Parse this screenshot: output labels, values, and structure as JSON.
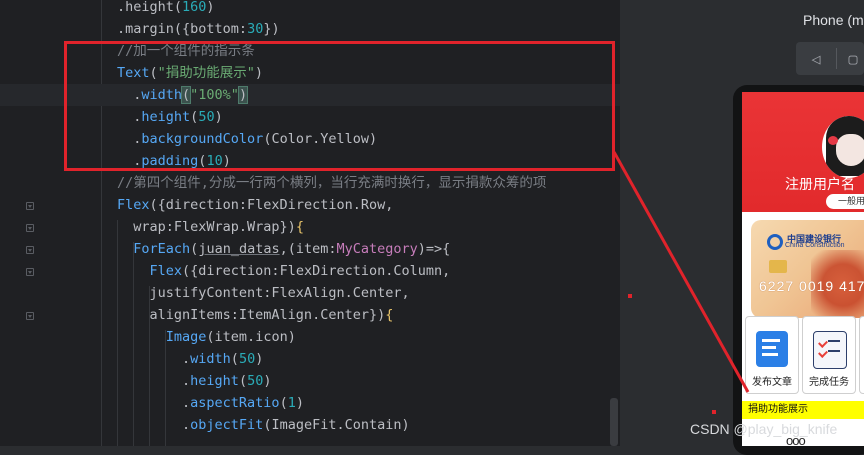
{
  "editor": {
    "lines": [
      [
        {
          "c": "plain",
          "t": ".height("
        },
        {
          "c": "num",
          "t": "160"
        },
        {
          "c": "plain",
          "t": ")"
        }
      ],
      [
        {
          "c": "plain",
          "t": ".margin({"
        },
        {
          "c": "plain",
          "t": "bottom:"
        },
        {
          "c": "num",
          "t": "30"
        },
        {
          "c": "plain",
          "t": "})"
        }
      ],
      [
        {
          "c": "cmt",
          "t": "//加一个组件的指示条"
        }
      ],
      [
        {
          "c": "kw-fn",
          "t": "Text"
        },
        {
          "c": "plain",
          "t": "("
        },
        {
          "c": "str",
          "t": "\"捐助功能展示\""
        },
        {
          "c": "plain",
          "t": ")"
        }
      ],
      [
        {
          "c": "plain",
          "t": "  ."
        },
        {
          "c": "kw-fn",
          "t": "width"
        },
        {
          "c": "brkt-hl",
          "t": "("
        },
        {
          "c": "str",
          "t": "\"100%\""
        },
        {
          "c": "brkt-hl",
          "t": ")"
        }
      ],
      [
        {
          "c": "plain",
          "t": "  ."
        },
        {
          "c": "kw-fn",
          "t": "height"
        },
        {
          "c": "plain",
          "t": "("
        },
        {
          "c": "num",
          "t": "50"
        },
        {
          "c": "plain",
          "t": ")"
        }
      ],
      [
        {
          "c": "plain",
          "t": "  ."
        },
        {
          "c": "kw-fn",
          "t": "backgroundColor"
        },
        {
          "c": "plain",
          "t": "(Color.Yellow)"
        }
      ],
      [
        {
          "c": "plain",
          "t": "  ."
        },
        {
          "c": "kw-fn",
          "t": "padding"
        },
        {
          "c": "plain",
          "t": "("
        },
        {
          "c": "num",
          "t": "10"
        },
        {
          "c": "plain",
          "t": ")"
        }
      ],
      [
        {
          "c": "cmt",
          "t": "//第四个组件,分成一行两个横列，当行充满时换行，显示捐款众筹的项"
        }
      ],
      [
        {
          "c": "kw-fn",
          "t": "Flex"
        },
        {
          "c": "plain",
          "t": "({direction:FlexDirection.Row,"
        }
      ],
      [
        {
          "c": "plain",
          "t": "  wrap:FlexWrap.Wrap})"
        },
        {
          "c": "brkt-y",
          "t": "{"
        }
      ],
      [
        {
          "c": "plain",
          "t": "  "
        },
        {
          "c": "kw-fn",
          "t": "ForEach"
        },
        {
          "c": "plain",
          "t": "("
        },
        {
          "c": "ul",
          "t": "juan_datas"
        },
        {
          "c": "plain",
          "t": ",(item:"
        },
        {
          "c": "type",
          "t": "MyCategory"
        },
        {
          "c": "plain",
          "t": ")=>{"
        }
      ],
      [
        {
          "c": "plain",
          "t": "    "
        },
        {
          "c": "kw-fn",
          "t": "Flex"
        },
        {
          "c": "plain",
          "t": "({direction:FlexDirection.Column,"
        }
      ],
      [
        {
          "c": "plain",
          "t": "    justifyContent:FlexAlign.Center,"
        }
      ],
      [
        {
          "c": "plain",
          "t": "    alignItems:ItemAlign.Center})"
        },
        {
          "c": "brkt-y",
          "t": "{"
        }
      ],
      [
        {
          "c": "plain",
          "t": "      "
        },
        {
          "c": "kw-fn",
          "t": "Image"
        },
        {
          "c": "plain",
          "t": "(item.icon)"
        }
      ],
      [
        {
          "c": "plain",
          "t": "        ."
        },
        {
          "c": "kw-fn",
          "t": "width"
        },
        {
          "c": "plain",
          "t": "("
        },
        {
          "c": "num",
          "t": "50"
        },
        {
          "c": "plain",
          "t": ")"
        }
      ],
      [
        {
          "c": "plain",
          "t": "        ."
        },
        {
          "c": "kw-fn",
          "t": "height"
        },
        {
          "c": "plain",
          "t": "("
        },
        {
          "c": "num",
          "t": "50"
        },
        {
          "c": "plain",
          "t": ")"
        }
      ],
      [
        {
          "c": "plain",
          "t": "        ."
        },
        {
          "c": "kw-fn",
          "t": "aspectRatio"
        },
        {
          "c": "plain",
          "t": "("
        },
        {
          "c": "num",
          "t": "1"
        },
        {
          "c": "plain",
          "t": ")"
        }
      ],
      [
        {
          "c": "plain",
          "t": "        ."
        },
        {
          "c": "kw-fn",
          "t": "objectFit"
        },
        {
          "c": "plain",
          "t": "(ImageFit.Contain)"
        }
      ]
    ]
  },
  "preview": {
    "title": "Phone (m",
    "register_text": "注册用户名",
    "pill_text": "一般用",
    "bank_name": "中国建设银行",
    "bank_name_en": "China Construction",
    "card_number": "6227 0019 417",
    "grid": [
      {
        "label": "发布文章",
        "icon": "article-icon"
      },
      {
        "label": "完成任务",
        "icon": "task-icon"
      },
      {
        "label": "",
        "icon": "partial-icon"
      }
    ],
    "yellow_text": "捐助功能展示",
    "dots": "ooo"
  },
  "watermark": "CSDN @play_big_knife",
  "colors": {
    "highlight_box": "#e0232b",
    "yellow_bar": "#ffff00",
    "banner_red": "#e22a2c"
  }
}
